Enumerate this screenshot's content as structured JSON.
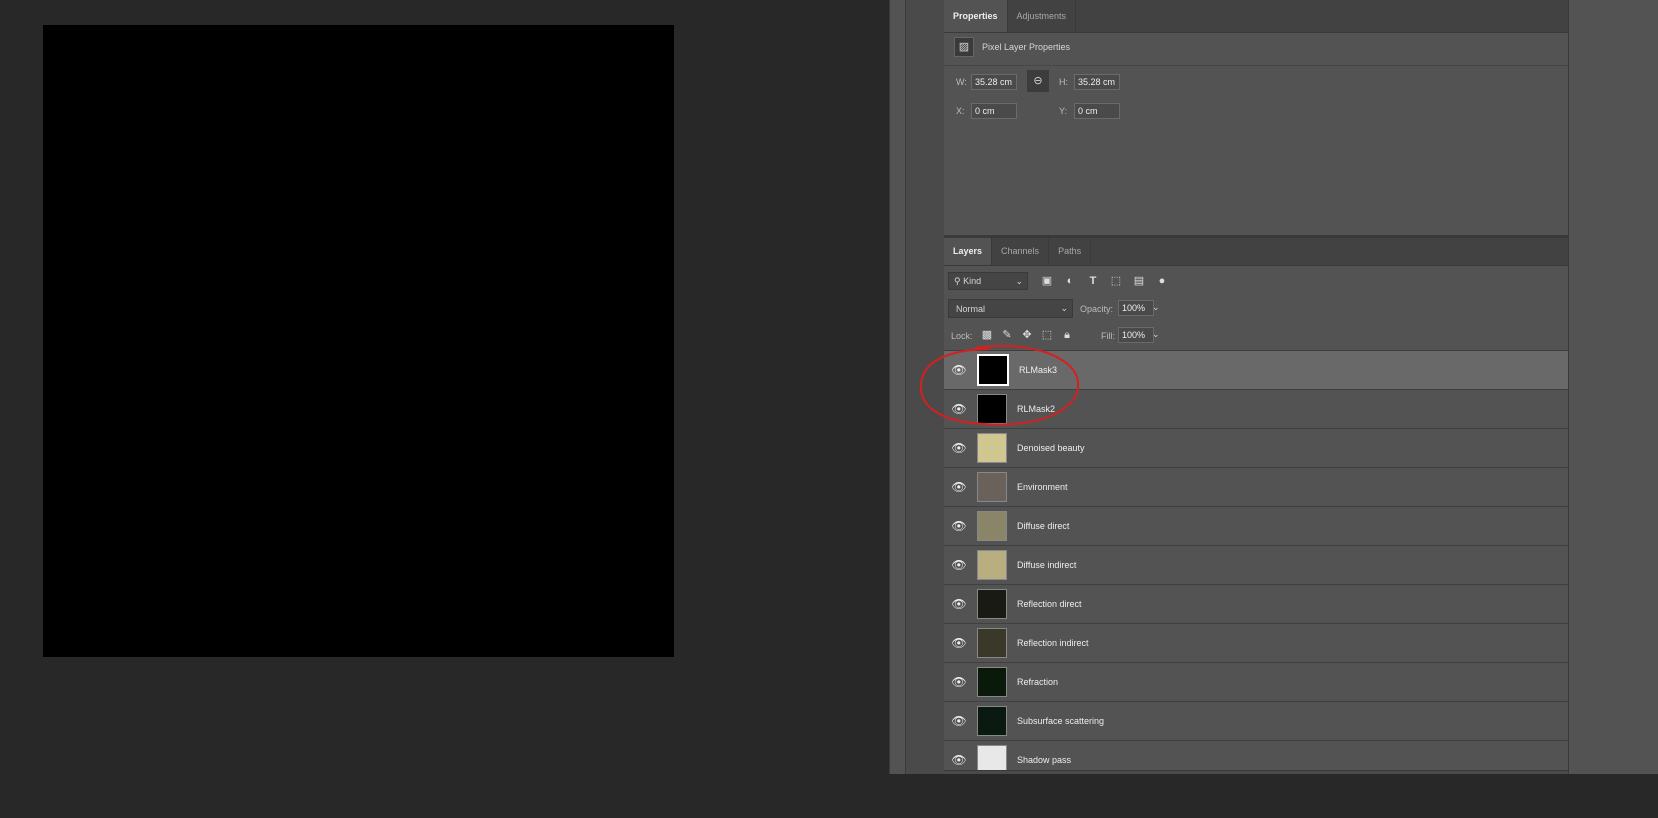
{
  "properties": {
    "tabs": [
      "Properties",
      "Adjustments"
    ],
    "title": "Pixel Layer Properties",
    "w_label": "W:",
    "w": "35.28 cm",
    "h_label": "H:",
    "h": "35.28 cm",
    "x_label": "X:",
    "x": "0 cm",
    "y_label": "Y:",
    "y": "0 cm"
  },
  "layers_panel": {
    "tabs": [
      "Layers",
      "Channels",
      "Paths"
    ],
    "filter": "Kind",
    "blend_mode": "Normal",
    "opacity_label": "Opacity:",
    "opacity": "100%",
    "lock_label": "Lock:",
    "fill_label": "Fill:",
    "fill": "100%",
    "layers": [
      {
        "name": "RLMask3",
        "selected": true,
        "thumb": "#000000"
      },
      {
        "name": "RLMask2",
        "thumb": "#000000"
      },
      {
        "name": "Denoised beauty",
        "thumb": "#cfc690"
      },
      {
        "name": "Environment",
        "thumb": "#6a625a"
      },
      {
        "name": "Diffuse direct",
        "thumb": "#8a8468"
      },
      {
        "name": "Diffuse indirect",
        "thumb": "#b8ae80"
      },
      {
        "name": "Reflection direct",
        "thumb": "#1a1a14"
      },
      {
        "name": "Reflection indirect",
        "thumb": "#3a3828"
      },
      {
        "name": "Refraction",
        "thumb": "#0a1a0a"
      },
      {
        "name": "Subsurface scattering",
        "thumb": "#0a1a10"
      },
      {
        "name": "Shadow pass",
        "thumb": "#e8e8e8"
      }
    ]
  },
  "annotation_color": "#d42020"
}
